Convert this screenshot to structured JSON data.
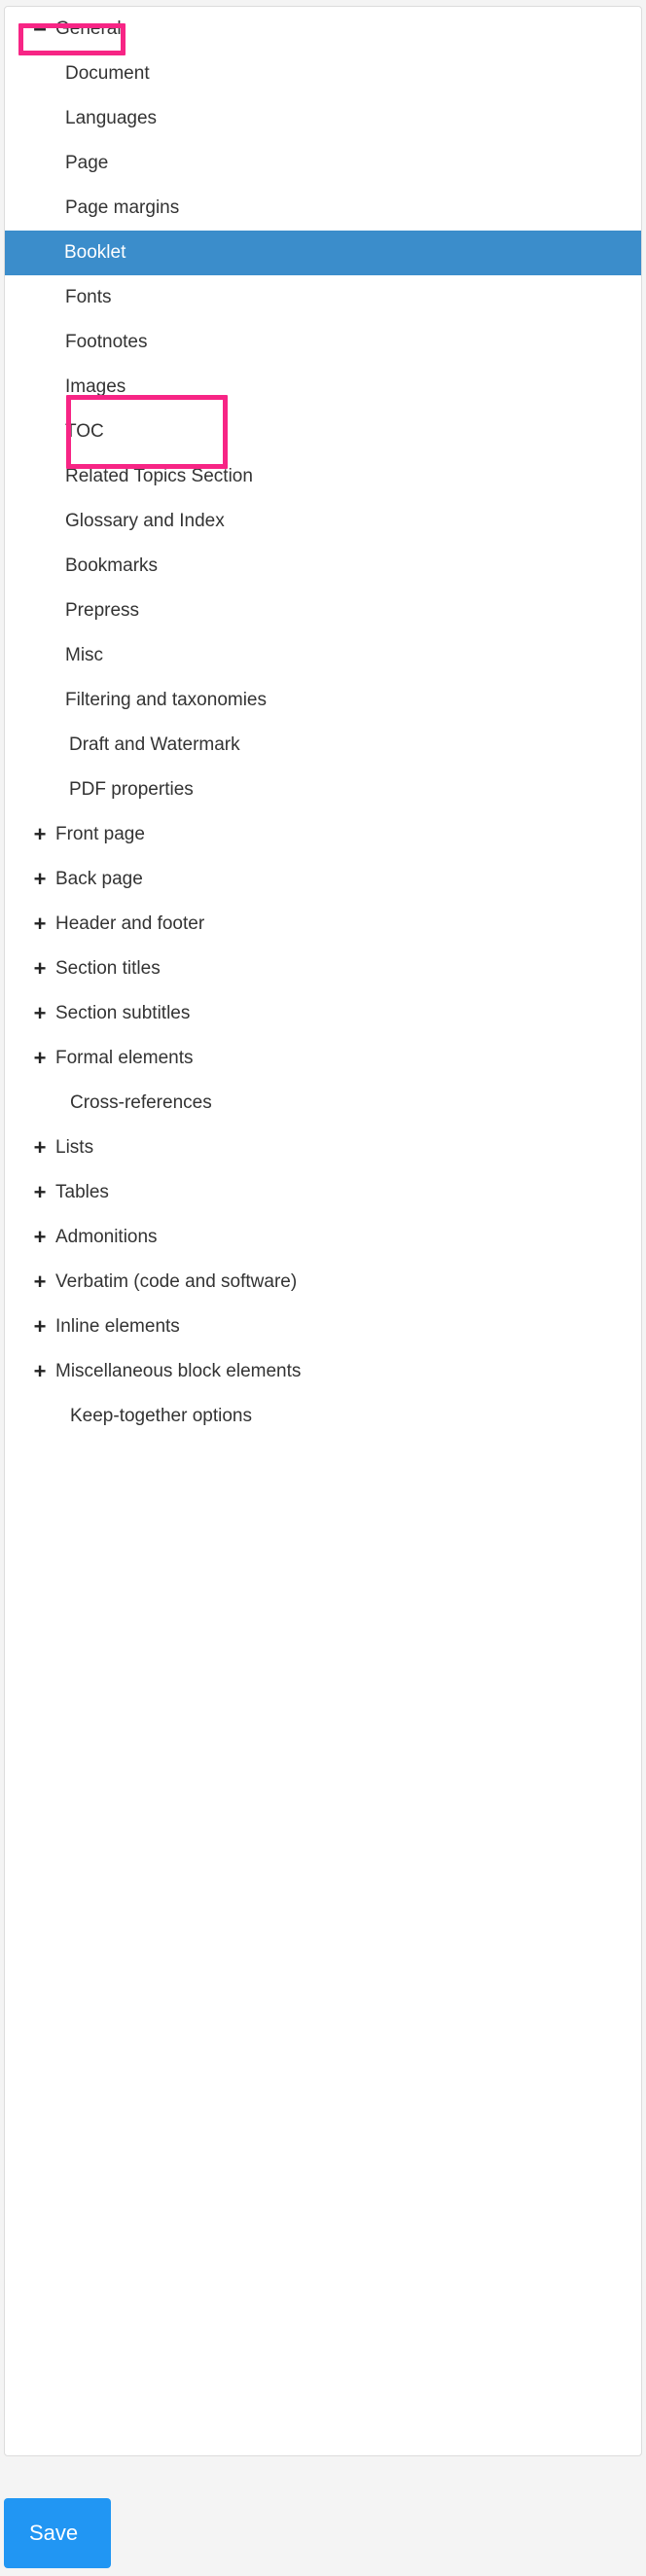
{
  "panel": {
    "name": "settings-navigation-panel"
  },
  "nav": {
    "items": [
      {
        "label": "General",
        "icon": "minus-icon",
        "level": "top",
        "selected": false,
        "highlighted": true
      },
      {
        "label": "Document",
        "icon": null,
        "level": "child",
        "selected": false,
        "highlighted": false
      },
      {
        "label": "Languages",
        "icon": null,
        "level": "child",
        "selected": false,
        "highlighted": false
      },
      {
        "label": "Page",
        "icon": null,
        "level": "child",
        "selected": false,
        "highlighted": false
      },
      {
        "label": "Page margins",
        "icon": null,
        "level": "child",
        "selected": false,
        "highlighted": false
      },
      {
        "label": "Booklet",
        "icon": null,
        "level": "child",
        "selected": true,
        "highlighted": true
      },
      {
        "label": "Fonts",
        "icon": null,
        "level": "child",
        "selected": false,
        "highlighted": false
      },
      {
        "label": "Footnotes",
        "icon": null,
        "level": "child",
        "selected": false,
        "highlighted": false
      },
      {
        "label": "Images",
        "icon": null,
        "level": "child",
        "selected": false,
        "highlighted": false
      },
      {
        "label": "TOC",
        "icon": null,
        "level": "child",
        "selected": false,
        "highlighted": false
      },
      {
        "label": "Related Topics Section",
        "icon": null,
        "level": "child",
        "selected": false,
        "highlighted": false
      },
      {
        "label": "Glossary and Index",
        "icon": null,
        "level": "child",
        "selected": false,
        "highlighted": false
      },
      {
        "label": "Bookmarks",
        "icon": null,
        "level": "child",
        "selected": false,
        "highlighted": false
      },
      {
        "label": "Prepress",
        "icon": null,
        "level": "child",
        "selected": false,
        "highlighted": false
      },
      {
        "label": "Misc",
        "icon": null,
        "level": "child",
        "selected": false,
        "highlighted": false
      },
      {
        "label": "Filtering and taxonomies",
        "icon": null,
        "level": "child",
        "selected": false,
        "highlighted": false
      },
      {
        "label": "Draft and Watermark",
        "icon": null,
        "level": "child-deep",
        "selected": false,
        "highlighted": false
      },
      {
        "label": "PDF properties",
        "icon": null,
        "level": "child-deep",
        "selected": false,
        "highlighted": false
      },
      {
        "label": "Front page",
        "icon": "plus-icon",
        "level": "top",
        "selected": false,
        "highlighted": false
      },
      {
        "label": "Back page",
        "icon": "plus-icon",
        "level": "top",
        "selected": false,
        "highlighted": false
      },
      {
        "label": "Header and footer",
        "icon": "plus-icon",
        "level": "top",
        "selected": false,
        "highlighted": false
      },
      {
        "label": "Section titles",
        "icon": "plus-icon",
        "level": "top",
        "selected": false,
        "highlighted": false
      },
      {
        "label": "Section subtitles",
        "icon": "plus-icon",
        "level": "top",
        "selected": false,
        "highlighted": false
      },
      {
        "label": "Formal elements",
        "icon": "plus-icon",
        "level": "top",
        "selected": false,
        "highlighted": false
      },
      {
        "label": "Cross-references",
        "icon": null,
        "level": "top-notoggle",
        "selected": false,
        "highlighted": false
      },
      {
        "label": "Lists",
        "icon": "plus-icon",
        "level": "top",
        "selected": false,
        "highlighted": false
      },
      {
        "label": "Tables",
        "icon": "plus-icon",
        "level": "top",
        "selected": false,
        "highlighted": false
      },
      {
        "label": "Admonitions",
        "icon": "plus-icon",
        "level": "top",
        "selected": false,
        "highlighted": false
      },
      {
        "label": "Verbatim (code and software)",
        "icon": "plus-icon",
        "level": "top",
        "selected": false,
        "highlighted": false
      },
      {
        "label": "Inline elements",
        "icon": "plus-icon",
        "level": "top",
        "selected": false,
        "highlighted": false
      },
      {
        "label": "Miscellaneous block elements",
        "icon": "plus-icon",
        "level": "top",
        "selected": false,
        "highlighted": false
      },
      {
        "label": "Keep-together options",
        "icon": null,
        "level": "top-notoggle",
        "selected": false,
        "highlighted": false
      }
    ],
    "glyphs": {
      "plus-icon": "+",
      "minus-icon": "–"
    }
  },
  "footer": {
    "save_label": "Save"
  },
  "colors": {
    "selected_row_bg": "#3b8dcb",
    "save_button_bg": "#2196f3",
    "annotation_outline": "#f72585",
    "panel_bg": "#ffffff",
    "page_bg": "#f4f4f4",
    "text": "#333333"
  }
}
